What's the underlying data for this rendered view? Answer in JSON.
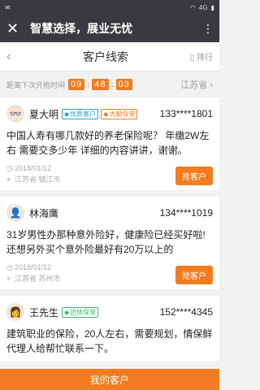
{
  "status_bar": {
    "carrier": "✉",
    "network": "4G"
  },
  "app_header": {
    "title": "智慧选择，展业无忧"
  },
  "nav": {
    "title": "客户线索",
    "rank_label": "排行"
  },
  "timer": {
    "label": "距离下次开抢时间",
    "h": "09",
    "m": "48",
    "s": "03",
    "province": "江苏省"
  },
  "leads": [
    {
      "name": "夏大明",
      "badges": [
        "优质客户",
        "大额保单"
      ],
      "phone": "133****1801",
      "content": "中国人寿有哪几款好的养老保险呢？ 年缴2W左右 需要交多少年 详细的内容讲讲，谢谢。",
      "date": "2018/01/12",
      "location": "江苏省 镇江市",
      "action": "抢客户"
    },
    {
      "name": "林海鹰",
      "badges": [],
      "phone": "134****1019",
      "content": "31岁男性办那种意外险好，健康险已经买好啦!还想另外买个意外险最好有20万以上的",
      "date": "2018/01/12",
      "location": "江苏省 苏州市",
      "action": "抢客户"
    },
    {
      "name": "王先生",
      "badges": [
        "团体保单"
      ],
      "phone": "152****4345",
      "content": "建筑职业的保险，20人左右，需要规划，情保鲜代理人给帮忙联系一下。",
      "date": "",
      "location": "",
      "action": ""
    }
  ],
  "bottom": {
    "label": "我的客户"
  }
}
